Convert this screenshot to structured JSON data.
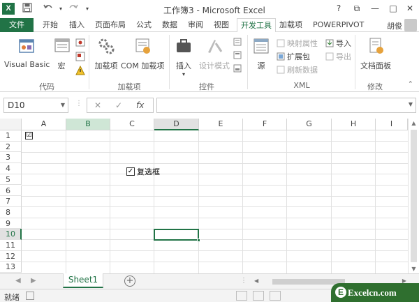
{
  "window": {
    "title": "工作簿3 - Microsoft Excel",
    "controls": {
      "help": "?",
      "restore": "⧉",
      "minimize": "—",
      "maximize": "□",
      "close": "✕"
    }
  },
  "qat": {
    "save_icon": "save-icon",
    "undo_icon": "undo-icon",
    "redo_icon": "redo-icon",
    "customize_icon": "customize-icon"
  },
  "tabs": [
    {
      "label": "文件"
    },
    {
      "label": "开始"
    },
    {
      "label": "插入"
    },
    {
      "label": "页面布局"
    },
    {
      "label": "公式"
    },
    {
      "label": "数据"
    },
    {
      "label": "审阅"
    },
    {
      "label": "视图"
    },
    {
      "label": "开发工具"
    },
    {
      "label": "加载项"
    },
    {
      "label": "POWERPIVOT"
    }
  ],
  "user": {
    "name": "胡俊"
  },
  "ribbon": {
    "code": {
      "visual_basic": "Visual Basic",
      "macro": "宏",
      "group_label": "代码"
    },
    "addins": {
      "addins": "加载项",
      "com_addins": "COM 加载项",
      "group_label": "加载项"
    },
    "controls": {
      "insert": "插入",
      "design_mode": "设计模式",
      "group_label": "控件"
    },
    "xml": {
      "source": "源",
      "map_properties": "映射属性",
      "expansion_packs": "扩展包",
      "refresh_data": "刷新数据",
      "import": "导入",
      "export": "导出",
      "group_label": "XML"
    },
    "modify": {
      "document_panel": "文档面板",
      "group_label": "修改"
    }
  },
  "formula_bar": {
    "name_box": "D10",
    "cancel": "✕",
    "enter": "✓",
    "fx": "fx",
    "value": ""
  },
  "grid": {
    "columns": [
      "A",
      "B",
      "C",
      "D",
      "E",
      "F",
      "G",
      "H",
      "I"
    ],
    "rows": [
      "1",
      "2",
      "3",
      "4",
      "5",
      "6",
      "7",
      "8",
      "9",
      "10",
      "11",
      "12",
      "13"
    ],
    "checkbox_small": "☑",
    "checkbox_control": {
      "label": "复选框",
      "checked": true
    }
  },
  "sheets": [
    {
      "name": "Sheet1"
    }
  ],
  "add_sheet": "+",
  "status": {
    "text": "就绪"
  },
  "watermark": {
    "text": "Excelcn.com"
  },
  "colors": {
    "brand": "#217346",
    "selection": "#cfe6d6"
  }
}
